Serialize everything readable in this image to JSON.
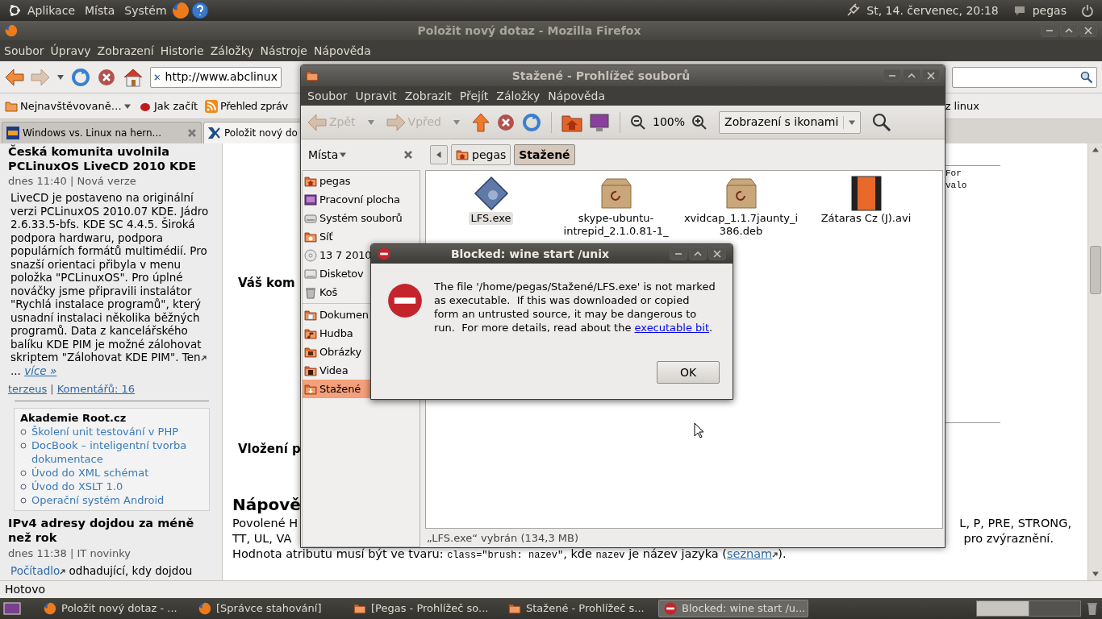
{
  "top_panel": {
    "menus": [
      "Aplikace",
      "Místa",
      "Systém"
    ],
    "clock": "St, 14. červenec, 20:18",
    "user": "pegas"
  },
  "firefox": {
    "title": "Položit nový dotaz - Mozilla Firefox",
    "menu": [
      "Soubor",
      "Úpravy",
      "Zobrazení",
      "Historie",
      "Záložky",
      "Nástroje",
      "Nápověda"
    ],
    "url": "http://www.abclinux",
    "bookmarks": [
      {
        "label": "Nejnavštěvovaně…",
        "kind": "folder"
      },
      {
        "label": "Jak začít",
        "kind": "page"
      },
      {
        "label": "Přehled zpráv",
        "kind": "feed"
      }
    ],
    "bookmark_right": "z linux",
    "tabs": [
      {
        "label": "Windows vs. Linux na hern...",
        "selected": false
      },
      {
        "label": "Položit nový do",
        "selected": true
      }
    ],
    "sidebar": {
      "article": {
        "title": "Česká komunita uvolnila PCLinuxOS LiveCD 2010 KDE",
        "meta": "dnes 11:40 | Nová verze",
        "body": "LiveCD je postaveno na originální verzi PCLinuxOS 2010.07 KDE. Jádro 2.6.33.5-bfs. KDE SC 4.4.5. Široká podpora hardwaru, podpora populárních formátů multimédií. Pro snazší orientaci přibyla v menu položka \"PCLinuxOS\". Pro úplné nováčky jsme připravili instalátor \"Rychlá instalace programů\", který usnadní instalaci několika běžných programů. Data z kancelářského balíku KDE PIM je možné zálohovat skriptem \"Zálohovat KDE PIM\".",
        "tail": "Ten",
        "ellipsis": "...",
        "more": "více »",
        "author": "terzeus",
        "separator": "|",
        "comments": "Komentářů: 16"
      },
      "box": {
        "title": "Akademie Root.cz",
        "items": [
          "Školení unit testování v PHP",
          "DocBook – inteligentní tvorba dokumentace",
          "Úvod do XML schémat",
          "Úvod do XSLT 1.0",
          "Operační systém Android"
        ]
      },
      "article2": {
        "title": "IPv4 adresy dojdou za méně než rok",
        "meta": "dnes 11:38 | IT novinky",
        "link": "Počítadlo",
        "body": "odhadující, kdy dojdou"
      }
    },
    "main": {
      "heading1": "Váš kom",
      "heading2": "Vložení p",
      "code_box": [
        "For",
        "valo"
      ],
      "help_heading": "Nápově",
      "line1_left": "Povolené H",
      "line1_right": "L, P, PRE, STRONG,",
      "line2_left": "TT, UL, VA",
      "line2_right": "pro zvýraznění.",
      "line3": [
        {
          "kind": "text",
          "text": "Hodnota atributu musí být ve tvaru: "
        },
        {
          "kind": "code",
          "text": "class=\"brush: nazev\""
        },
        {
          "kind": "text",
          "text": ", kde "
        },
        {
          "kind": "code",
          "text": "nazev"
        },
        {
          "kind": "text",
          "text": " je název jazyka ("
        },
        {
          "kind": "link",
          "text": "seznam"
        },
        {
          "kind": "text",
          "text": ")."
        }
      ]
    },
    "status": "Hotovo"
  },
  "nautilus": {
    "title": "Stažené - Prohlížeč souborů",
    "menu": [
      "Soubor",
      "Upravit",
      "Zobrazit",
      "Přejít",
      "Záložky",
      "Nápověda"
    ],
    "back": {
      "label": "Zpět",
      "disabled": true
    },
    "forward": {
      "label": "Vpřed",
      "disabled": true
    },
    "zoom": "100%",
    "view": "Zobrazení s ikonami",
    "sidebar_title": "Místa",
    "places": [
      {
        "label": "pegas",
        "kind": "home",
        "selected": false
      },
      {
        "label": "Pracovní plocha",
        "kind": "desktop",
        "selected": false
      },
      {
        "label": "Systém souborů",
        "kind": "drive",
        "selected": false
      },
      {
        "label": "Síť",
        "kind": "network",
        "selected": false
      },
      {
        "label": "13 7 2010",
        "kind": "disc",
        "selected": false
      },
      {
        "label": "Disketov",
        "kind": "floppy",
        "selected": false
      },
      {
        "label": "Koš",
        "kind": "trash",
        "selected": false
      }
    ],
    "bookmarks": [
      {
        "label": "Dokumen",
        "kind": "documents",
        "selected": false
      },
      {
        "label": "Hudba",
        "kind": "music",
        "selected": false
      },
      {
        "label": "Obrázky",
        "kind": "pictures",
        "selected": false
      },
      {
        "label": "Videa",
        "kind": "videos",
        "selected": false
      },
      {
        "label": "Stažené",
        "kind": "downloads",
        "selected": true
      }
    ],
    "path": [
      {
        "label": "pegas",
        "selected": false
      },
      {
        "label": "Stažené",
        "selected": true
      }
    ],
    "files": [
      {
        "name": "LFS.exe",
        "kind": "exe",
        "selected": true
      },
      {
        "name": "skype-ubuntu-intrepid_2.1.0.81-1_",
        "kind": "deb",
        "selected": false
      },
      {
        "name": "xvidcap_1.1.7jaunty_i386.deb",
        "kind": "deb",
        "selected": false
      },
      {
        "name": "Zátaras Cz (J).avi",
        "kind": "video",
        "selected": false
      }
    ],
    "status": "„LFS.exe“ vybrán (134,3 MB)"
  },
  "dialog": {
    "title": "Blocked: wine start /unix",
    "message": "The file '/home/pegas/Stažené/LFS.exe' is not marked as executable.  If this was downloaded or copied form an untrusted source, it may be dangerous to run.  For more details, read about the ",
    "link": "executable bit",
    "end": ".",
    "button": "OK"
  },
  "taskbar": [
    {
      "label": "Položit nový dotaz - ...",
      "kind": "firefox",
      "selected": false
    },
    {
      "label": "[Správce stahování]",
      "kind": "firefox",
      "selected": false
    },
    {
      "label": "[Pegas - Prohlížeč so...",
      "kind": "folder",
      "selected": false
    },
    {
      "label": "Stažené - Prohlížeč s...",
      "kind": "folder",
      "selected": false
    },
    {
      "label": "Blocked: wine start /u...",
      "kind": "blocked",
      "selected": true
    }
  ]
}
